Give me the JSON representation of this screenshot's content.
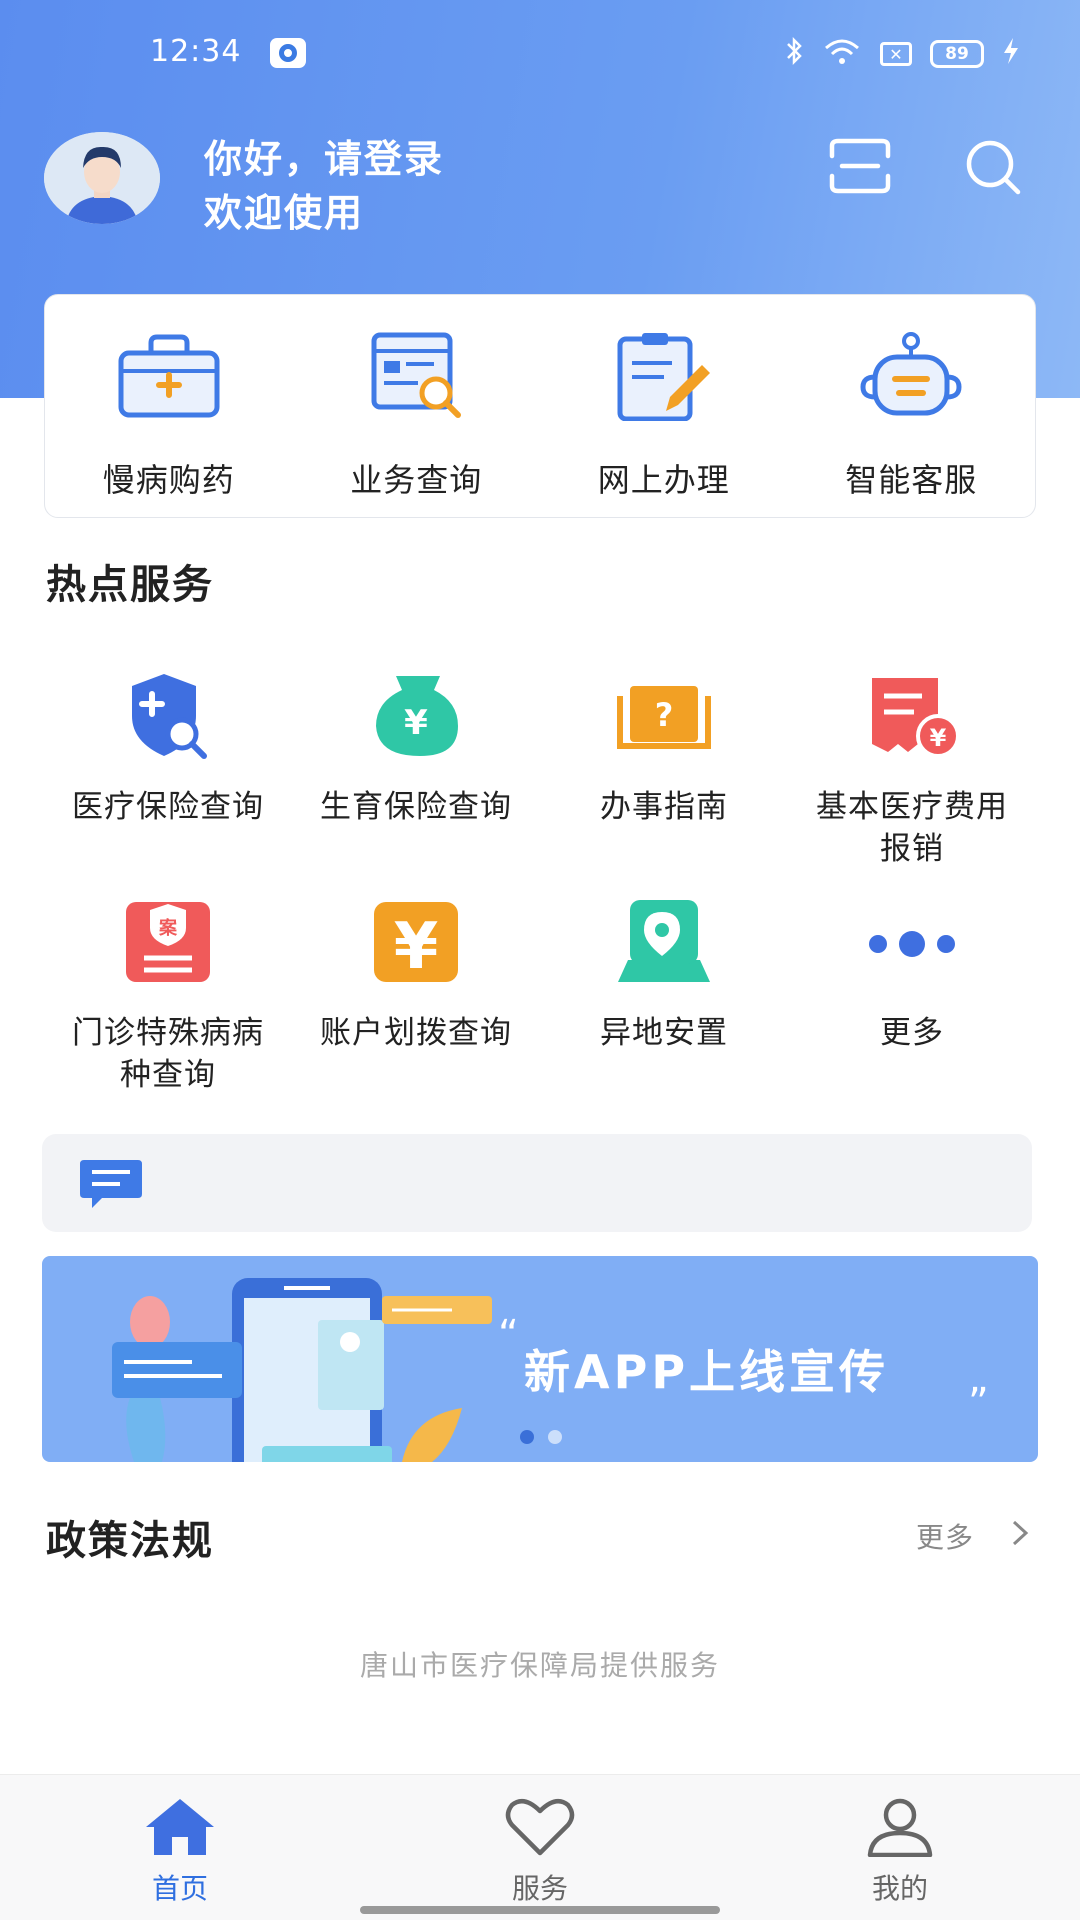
{
  "status_bar": {
    "time": "12:34",
    "battery": "89"
  },
  "header": {
    "greeting": "你好，请登录",
    "welcome": "欢迎使用"
  },
  "quick_actions": [
    {
      "label": "慢病购药",
      "icon": "medicine-box-icon"
    },
    {
      "label": "业务查询",
      "icon": "document-search-icon"
    },
    {
      "label": "网上办理",
      "icon": "clipboard-edit-icon"
    },
    {
      "label": "智能客服",
      "icon": "robot-icon"
    }
  ],
  "hot_services": {
    "title": "热点服务",
    "items": [
      {
        "label": "医疗保险查询",
        "icon": "shield-search-icon",
        "color": "#3f6fe0"
      },
      {
        "label": "生育保险查询",
        "icon": "money-bag-icon",
        "color": "#2fc7a6"
      },
      {
        "label": "办事指南",
        "icon": "guide-book-icon",
        "color": "#f2a024"
      },
      {
        "label": "基本医疗费用报销",
        "icon": "receipt-yuan-icon",
        "color": "#f05a5a"
      },
      {
        "label": "门诊特殊病病种查询",
        "icon": "case-file-icon",
        "color": "#f05a5a"
      },
      {
        "label": "账户划拨查询",
        "icon": "yuan-coin-icon",
        "color": "#f2a024"
      },
      {
        "label": "异地安置",
        "icon": "map-location-icon",
        "color": "#2fc7a6"
      },
      {
        "label": "更多",
        "icon": "more-dots-icon",
        "color": "#3f6fe0"
      }
    ]
  },
  "banner": {
    "text": "新APP上线宣传"
  },
  "policy": {
    "title": "政策法规",
    "more": "更多"
  },
  "footer": {
    "text": "唐山市医疗保障局提供服务"
  },
  "tabs": [
    {
      "label": "首页",
      "icon": "home-icon",
      "active": true
    },
    {
      "label": "服务",
      "icon": "heart-icon",
      "active": false
    },
    {
      "label": "我的",
      "icon": "user-icon",
      "active": false
    }
  ],
  "colors": {
    "primary": "#3f6fe0",
    "header": "#5b8def",
    "banner": "#80aef5"
  }
}
